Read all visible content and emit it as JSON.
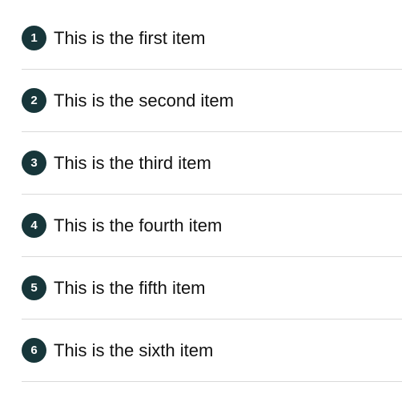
{
  "list": {
    "items": [
      {
        "number": "1",
        "label": "This is the first item"
      },
      {
        "number": "2",
        "label": "This is the second item"
      },
      {
        "number": "3",
        "label": "This is the third item"
      },
      {
        "number": "4",
        "label": "This is the fourth item"
      },
      {
        "number": "5",
        "label": "This is the fifth item"
      },
      {
        "number": "6",
        "label": "This is the sixth item"
      }
    ]
  },
  "colors": {
    "badge_background": "#17363a",
    "badge_text": "#ffffff",
    "divider": "#d9d9d9",
    "label_text": "#111111"
  }
}
